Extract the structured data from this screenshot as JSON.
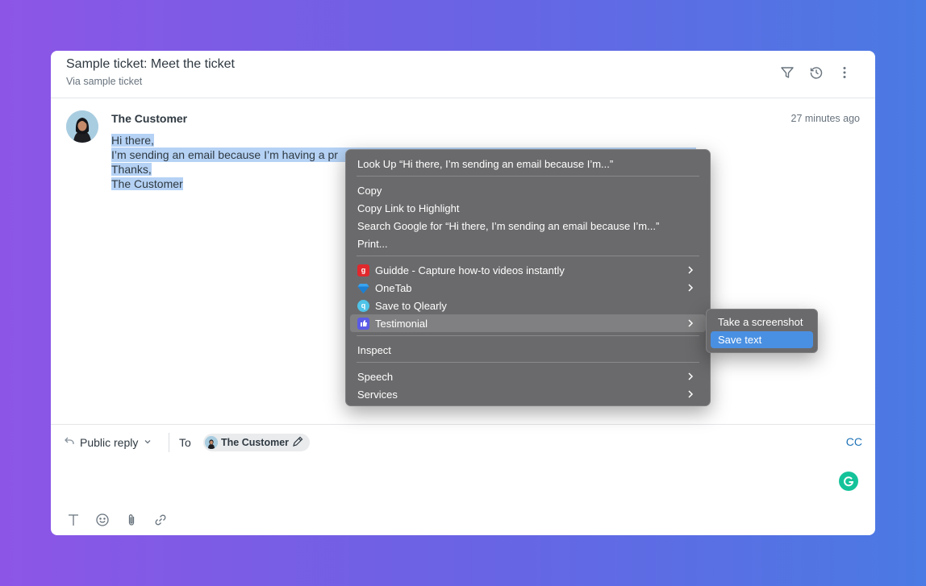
{
  "ticket": {
    "title": "Sample ticket: Meet the ticket",
    "subtitle": "Via sample ticket"
  },
  "header_icons": [
    "filter-icon",
    "history-icon",
    "more-vertical-icon"
  ],
  "message": {
    "author": "The Customer",
    "time": "27 minutes ago",
    "lines": [
      "Hi there,",
      "I’m sending an email because I’m having a pr",
      "Thanks,",
      "The Customer"
    ]
  },
  "context_menu": {
    "lookup": "Look Up “Hi there,  I’m sending an email because I’m...”",
    "copy": "Copy",
    "copy_link": "Copy Link to Highlight",
    "search_google": "Search Google for “Hi there,  I’m sending an email because I’m...”",
    "print": "Print...",
    "guidde": "Guidde - Capture how-to videos instantly",
    "onetab": "OneTab",
    "qlearly": "Save to Qlearly",
    "testimonial": "Testimonial",
    "inspect": "Inspect",
    "speech": "Speech",
    "services": "Services"
  },
  "submenu": {
    "take_screenshot": "Take a screenshot",
    "save_text": "Save text"
  },
  "composer": {
    "reply_type": "Public reply",
    "to_label": "To",
    "recipient": "The Customer",
    "cc": "CC"
  },
  "colors": {
    "highlight": "#b5d2f5",
    "menu_bg": "#6a6a6c",
    "submenu_active": "#4a90e2",
    "cc_link": "#1f73b7",
    "grammarly": "#15c39a"
  }
}
